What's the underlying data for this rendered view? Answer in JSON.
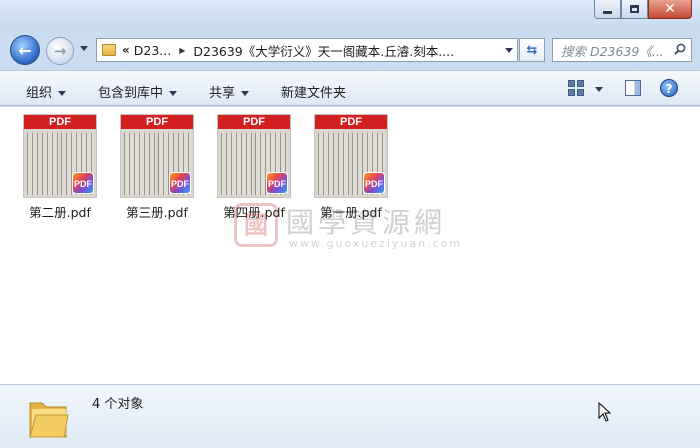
{
  "window": {
    "caption_buttons": [
      "minimize",
      "maximize",
      "close"
    ]
  },
  "nav": {
    "chevron": "«",
    "crumbs": [
      "D23...",
      "D23639《大学衍义》天一阁藏本.丘濬.刻本...."
    ],
    "search_placeholder": "搜索 D23639《..."
  },
  "toolbar": {
    "organize": "组织",
    "include_in_library": "包含到库中",
    "share": "共享",
    "new_folder": "新建文件夹"
  },
  "files": [
    {
      "name": "第二册.pdf",
      "band": "PDF",
      "badge": "PDF"
    },
    {
      "name": "第三册.pdf",
      "band": "PDF",
      "badge": "PDF"
    },
    {
      "name": "第四册.pdf",
      "band": "PDF",
      "badge": "PDF"
    },
    {
      "name": "第一册.pdf",
      "band": "PDF",
      "badge": "PDF"
    }
  ],
  "watermark": {
    "seal": "國",
    "title": "國學資源網",
    "url": "www.guoxueziyuan.com"
  },
  "status": {
    "count": "4 个对象"
  },
  "colors": {
    "pdf_red": "#d21f1f",
    "window_frame": "#c9dcf0",
    "toolbar_bg": "#dde8f5"
  }
}
